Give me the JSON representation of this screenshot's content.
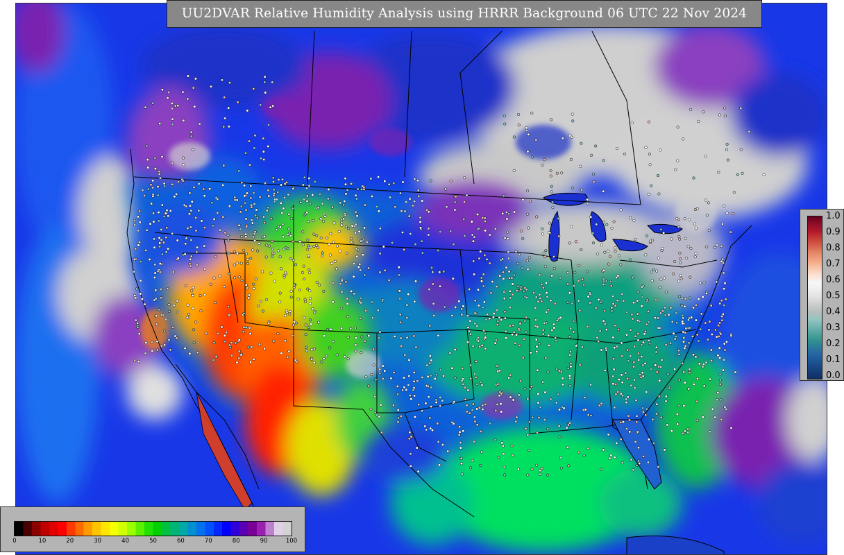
{
  "title": "UU2DVAR Relative Humidity Analysis using HRRR Background 06 UTC 22 Nov 2024",
  "innovation_legend": {
    "ticks": [
      "1.0",
      "0.9",
      "0.8",
      "0.7",
      "0.6",
      "0.5",
      "0.4",
      "0.3",
      "0.2",
      "0.1",
      "0.0"
    ],
    "colors": [
      "#67001f",
      "#8e0d25",
      "#b2182b",
      "#c63d36",
      "#d6604d",
      "#e58a69",
      "#f4a582",
      "#f8c5ab",
      "#fbe2d4",
      "#f7f7f7",
      "#ededed",
      "#e0e0e0",
      "#cccccc",
      "#b4bdbd",
      "#92c5c0",
      "#6fb3ad",
      "#4aa19b",
      "#2e8e8e",
      "#2a74a0",
      "#2160a0",
      "#1a4f8c",
      "#143e78",
      "#0e2e62"
    ]
  },
  "rh_legend": {
    "ticks": [
      "0",
      "10",
      "20",
      "30",
      "40",
      "50",
      "60",
      "70",
      "80",
      "90",
      "100"
    ],
    "colors": [
      "#000000",
      "#4a0000",
      "#8b0000",
      "#c00000",
      "#e00000",
      "#ff0000",
      "#ff3a00",
      "#ff6a00",
      "#ff9a00",
      "#ffc400",
      "#ffe600",
      "#f5ff00",
      "#cfff00",
      "#9cff00",
      "#5cf000",
      "#22e000",
      "#00d000",
      "#00c040",
      "#00b478",
      "#00a8a8",
      "#0090d0",
      "#0070f0",
      "#0050ff",
      "#0028ff",
      "#0000ff",
      "#3000d8",
      "#5a00b4",
      "#7a0098",
      "#9a20b0",
      "#c080d0",
      "#e0d0e8",
      "#d2d2d2"
    ]
  },
  "colors": {
    "ocean": "#1838e8",
    "land_base": "#0f9a8a",
    "dry": "#ff2200",
    "moist": "#7a1fa8",
    "saturated": "#d0d0d0",
    "gulf": "#00e060",
    "border": "#000000",
    "banner_bg": "#888888",
    "legend_bg": "#b4b4b4"
  }
}
